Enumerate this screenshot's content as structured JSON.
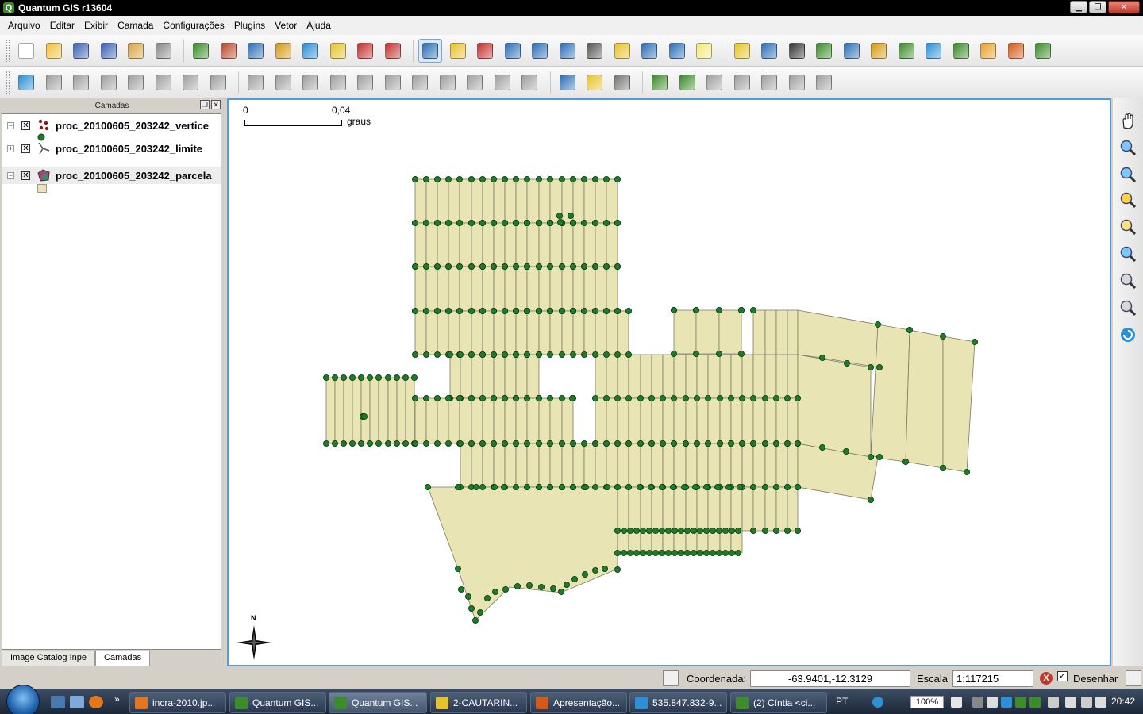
{
  "window": {
    "title": "Quantum GIS r13604",
    "controls": [
      "minimize",
      "maximize",
      "close"
    ]
  },
  "menu": [
    "Arquivo",
    "Editar",
    "Exibir",
    "Camada",
    "Configurações",
    "Plugins",
    "Vetor",
    "Ajuda"
  ],
  "toolbar1": {
    "groups": [
      [
        {
          "icon": "new-project-icon",
          "color": "#ffffff"
        },
        {
          "icon": "open-project-icon",
          "color": "#f0c23b"
        },
        {
          "icon": "save-project-icon",
          "color": "#3a63b8"
        },
        {
          "icon": "save-as-icon",
          "color": "#3a63b8"
        },
        {
          "icon": "print-composer-icon",
          "color": "#d9a441"
        },
        {
          "icon": "print-icon",
          "color": "#8a8a8a"
        }
      ],
      [
        {
          "icon": "add-vector-layer-icon",
          "color": "#3b8c2a"
        },
        {
          "icon": "add-raster-layer-icon",
          "color": "#b8472a"
        },
        {
          "icon": "add-postgis-layer-icon",
          "color": "#2d6fb7"
        },
        {
          "icon": "add-spatialite-layer-icon",
          "color": "#d59a17"
        },
        {
          "icon": "add-wms-layer-icon",
          "color": "#2d8fd5"
        },
        {
          "icon": "new-vector-layer-icon",
          "color": "#e6c32b"
        },
        {
          "icon": "remove-layer-icon",
          "color": "#c43030"
        },
        {
          "icon": "add-wfs-layer-icon",
          "color": "#c43030"
        }
      ],
      [
        {
          "icon": "identify-icon",
          "color": "#2d6fb7",
          "active": true
        },
        {
          "icon": "select-features-icon",
          "color": "#e6c32b"
        },
        {
          "icon": "deselect-icon",
          "color": "#c43030"
        },
        {
          "icon": "attribute-table-icon",
          "color": "#2d6fb7"
        },
        {
          "icon": "measure-line-icon",
          "color": "#2d6fb7"
        },
        {
          "icon": "measure-area-icon",
          "color": "#2d6fb7"
        },
        {
          "icon": "measure-angle-icon",
          "color": "#555555"
        },
        {
          "icon": "map-tips-icon",
          "color": "#e6c32b"
        },
        {
          "icon": "new-bookmark-icon",
          "color": "#2d6fb7"
        },
        {
          "icon": "show-bookmarks-icon",
          "color": "#2d6fb7"
        },
        {
          "icon": "text-annotation-icon",
          "color": "#f3e97a"
        }
      ],
      [
        {
          "icon": "d2s-plugin-icon",
          "color": "#e6c32b"
        },
        {
          "icon": "north-arrow-icon",
          "color": "#2d6fb7"
        },
        {
          "icon": "scale-bar-icon",
          "color": "#333333"
        },
        {
          "icon": "copyright-label-icon",
          "color": "#3b8c2a"
        },
        {
          "icon": "gps-tools-icon",
          "color": "#2d6fb7"
        },
        {
          "icon": "georeferencer-icon",
          "color": "#d59a17"
        },
        {
          "icon": "grass-tools-icon",
          "color": "#3b8c2a"
        },
        {
          "icon": "quick-print-icon",
          "color": "#2d8fd5"
        },
        {
          "icon": "plugin-tool-icon",
          "color": "#3b8c2a"
        },
        {
          "icon": "plugin-edit-icon",
          "color": "#e6a12b"
        },
        {
          "icon": "plugin-book-icon",
          "color": "#d55a17"
        },
        {
          "icon": "plugin-map-icon",
          "color": "#3b8c2a"
        }
      ]
    ]
  },
  "toolbar2": {
    "groups": [
      [
        {
          "icon": "toggle-editing-icon",
          "color": "#2d8fd5"
        },
        {
          "icon": "save-edits-icon",
          "color": "#a0a0a0"
        },
        {
          "icon": "move-feature-icon",
          "color": "#a0a0a0"
        },
        {
          "icon": "node-tool-icon",
          "color": "#a0a0a0"
        },
        {
          "icon": "delete-selected-icon",
          "color": "#a0a0a0"
        },
        {
          "icon": "cut-features-icon",
          "color": "#a0a0a0"
        },
        {
          "icon": "copy-features-icon",
          "color": "#a0a0a0"
        },
        {
          "icon": "paste-features-icon",
          "color": "#a0a0a0"
        }
      ],
      [
        {
          "icon": "undo-icon",
          "color": "#a0a0a0"
        },
        {
          "icon": "redo-icon",
          "color": "#a0a0a0"
        },
        {
          "icon": "simplify-feature-icon",
          "color": "#a0a0a0"
        },
        {
          "icon": "add-ring-icon",
          "color": "#a0a0a0"
        },
        {
          "icon": "add-part-icon",
          "color": "#a0a0a0"
        },
        {
          "icon": "delete-ring-icon",
          "color": "#a0a0a0"
        },
        {
          "icon": "delete-part-icon",
          "color": "#a0a0a0"
        },
        {
          "icon": "reshape-features-icon",
          "color": "#a0a0a0"
        },
        {
          "icon": "split-features-icon",
          "color": "#a0a0a0"
        },
        {
          "icon": "merge-features-icon",
          "color": "#a0a0a0"
        },
        {
          "icon": "rotate-symbols-icon",
          "color": "#a0a0a0"
        }
      ],
      [
        {
          "icon": "vector-edit-plugin-icon",
          "color": "#2d6fb7"
        },
        {
          "icon": "star-plugin-icon",
          "color": "#e6c32b"
        },
        {
          "icon": "tools-plugin-icon",
          "color": "#777777"
        }
      ],
      [
        {
          "icon": "grass-region-icon",
          "color": "#3b8c2a"
        },
        {
          "icon": "grass-edit-icon",
          "color": "#3b8c2a"
        },
        {
          "icon": "digitize-plugin-icon",
          "color": "#a0a0a0"
        },
        {
          "icon": "digitize-line-icon",
          "color": "#a0a0a0"
        },
        {
          "icon": "digitize-curve-icon",
          "color": "#a0a0a0"
        },
        {
          "icon": "table-plugin-icon",
          "color": "#a0a0a0"
        },
        {
          "icon": "table-edit-plugin-icon",
          "color": "#a0a0a0"
        }
      ]
    ]
  },
  "layers_panel": {
    "title": "Camadas",
    "layers": [
      {
        "name": "proc_20100605_203242_vertice",
        "checked": "✕",
        "expander": "−",
        "icon": "point-layer-icon",
        "legend": "green-point-icon"
      },
      {
        "name": "proc_20100605_203242_limite",
        "checked": "✕",
        "expander": "+",
        "icon": "line-layer-icon"
      },
      {
        "name": "proc_20100605_203242_parcela",
        "checked": "✕",
        "expander": "−",
        "icon": "polygon-layer-icon",
        "legend": "beige-polygon-icon"
      }
    ],
    "tabs": [
      "Image Catalog Inpe",
      "Camadas"
    ],
    "active_tab": "Camadas"
  },
  "map": {
    "scale_bar": {
      "start": "0",
      "end": "0,04",
      "unit": "graus"
    },
    "north_arrow_label": "N",
    "fill_color": "#e8e4b4",
    "stroke_color": "#7a7a62",
    "vertex_color": "#1f7a2a"
  },
  "map_nav": [
    "pan-icon",
    "zoom-in-icon",
    "zoom-out-icon",
    "zoom-full-icon",
    "zoom-selection-icon",
    "zoom-layer-icon",
    "zoom-last-icon",
    "zoom-next-icon",
    "refresh-icon"
  ],
  "status": {
    "coordinate_label": "Coordenada:",
    "coordinate_value": "-63.9401,-12.3129",
    "scale_label": "Escala",
    "scale_value": "1:117215",
    "render_label": "Desenhar",
    "stop_symbol": "X"
  },
  "taskbar": {
    "buttons": [
      {
        "label": "incra-2010.jp...",
        "color": "#e5761b"
      },
      {
        "label": "Quantum GIS...",
        "color": "#3b8c2a"
      },
      {
        "label": "Quantum GIS...",
        "color": "#3b8c2a",
        "active": true
      },
      {
        "label": "2-CAUTARIN...",
        "color": "#e6c32b"
      },
      {
        "label": "Apresentação...",
        "color": "#d55a17"
      },
      {
        "label": "535.847.832-9...",
        "color": "#2d8fd5"
      },
      {
        "label": "(2) Cíntia <ci...",
        "color": "#3b8c2a"
      }
    ],
    "lang": "PT",
    "battery": "100%",
    "clock": "20:42"
  }
}
